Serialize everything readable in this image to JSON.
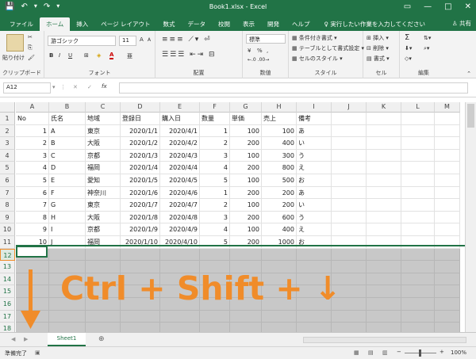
{
  "titlebar": {
    "title": "Book1.xlsx  -  Excel",
    "save": "💾",
    "undo": "↶",
    "undo_dd": "▾",
    "redo": "↷",
    "qat_more": "▾",
    "ribbon_opt": "▭",
    "min": "—",
    "max": "□",
    "close": "✕"
  },
  "tabs": [
    "ファイル",
    "ホーム",
    "挿入",
    "ページ レイアウト",
    "数式",
    "データ",
    "校閲",
    "表示",
    "開発",
    "ヘルプ"
  ],
  "tellme": "実行したい作業を入力してください",
  "share": "共有",
  "ribbon": {
    "paste": "貼り付け",
    "clipboard": "クリップボード",
    "font_name": "游ゴシック",
    "font_size": "11",
    "grow": "A",
    "shrink": "A",
    "bold": "B",
    "italic": "I",
    "underline": "U",
    "font_color": "A",
    "phonetic": "亜",
    "font_group": "フォント",
    "align_group": "配置",
    "number_format": "標準",
    "pct": "%",
    "comma": ",",
    "number_group": "数値",
    "cond": "条件付き書式",
    "table": "テーブルとして書式設定",
    "cellstyle": "セルのスタイル",
    "style_group": "スタイル",
    "insert": "挿入",
    "delete": "削除",
    "format": "書式",
    "cells_group": "セル",
    "sum": "Σ",
    "edit_group": "編集"
  },
  "formula": {
    "namebox": "A12",
    "cancel": "✕",
    "enter": "✓",
    "fx": "fx"
  },
  "columns": [
    "A",
    "B",
    "C",
    "D",
    "E",
    "F",
    "G",
    "H",
    "I",
    "J",
    "K",
    "L",
    "M"
  ],
  "header": [
    "No",
    "氏名",
    "地域",
    "登録日",
    "購入日",
    "数量",
    "単価",
    "売上",
    "備考"
  ],
  "rows": [
    [
      "1",
      "A",
      "東京",
      "2020/1/1",
      "2020/4/1",
      "1",
      "100",
      "100",
      "あ"
    ],
    [
      "2",
      "B",
      "大阪",
      "2020/1/2",
      "2020/4/2",
      "2",
      "200",
      "400",
      "い"
    ],
    [
      "3",
      "C",
      "京都",
      "2020/1/3",
      "2020/4/3",
      "3",
      "100",
      "300",
      "う"
    ],
    [
      "4",
      "D",
      "福岡",
      "2020/1/4",
      "2020/4/4",
      "4",
      "200",
      "800",
      "え"
    ],
    [
      "5",
      "E",
      "愛知",
      "2020/1/5",
      "2020/4/5",
      "5",
      "100",
      "500",
      "お"
    ],
    [
      "6",
      "F",
      "神奈川",
      "2020/1/6",
      "2020/4/6",
      "1",
      "200",
      "200",
      "あ"
    ],
    [
      "7",
      "G",
      "東京",
      "2020/1/7",
      "2020/4/7",
      "2",
      "100",
      "200",
      "い"
    ],
    [
      "8",
      "H",
      "大阪",
      "2020/1/8",
      "2020/4/8",
      "3",
      "200",
      "600",
      "う"
    ],
    [
      "9",
      "I",
      "京都",
      "2020/1/9",
      "2020/4/9",
      "4",
      "100",
      "400",
      "え"
    ],
    [
      "10",
      "J",
      "福岡",
      "2020/1/10",
      "2020/4/10",
      "5",
      "200",
      "1000",
      "お"
    ]
  ],
  "row_numbers": [
    "1",
    "2",
    "3",
    "4",
    "5",
    "6",
    "7",
    "8",
    "9",
    "10",
    "11",
    "12",
    "13",
    "14",
    "15",
    "16",
    "17",
    "18"
  ],
  "overlay": "Ctrl + Shift + ↓",
  "sheet_tab": "Sheet1",
  "status": {
    "ready": "準備完了",
    "zoom": "100%",
    "minus": "−",
    "plus": "+"
  },
  "colors": {
    "accent": "#217346",
    "overlay": "#f08c2a",
    "selection": "#c8c8c8"
  }
}
